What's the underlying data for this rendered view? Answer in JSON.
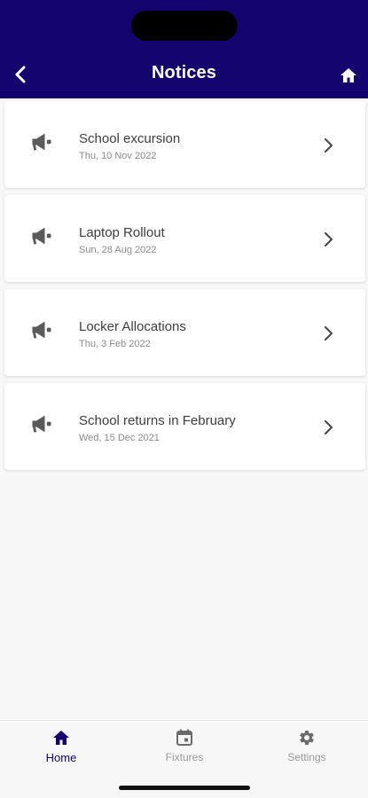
{
  "header": {
    "title": "Notices",
    "colors": {
      "background": "#13036e",
      "text": "#ffffff"
    },
    "left_icon": "chevron-left-icon",
    "right_icon": "home-icon"
  },
  "notices": [
    {
      "title": "School excursion",
      "date": "Thu, 10 Nov 2022"
    },
    {
      "title": "Laptop Rollout",
      "date": "Sun, 28 Aug 2022"
    },
    {
      "title": "Locker Allocations",
      "date": "Thu, 3 Feb 2022"
    },
    {
      "title": "School returns in February",
      "date": "Wed, 15 Dec 2021"
    }
  ],
  "notice_icon": "megaphone-icon",
  "bottom_nav": {
    "items": [
      {
        "label": "Home",
        "icon": "home-icon",
        "active": true
      },
      {
        "label": "Fixtures",
        "icon": "calendar-icon",
        "active": false
      },
      {
        "label": "Settings",
        "icon": "gear-icon",
        "active": false
      }
    ],
    "active_color": "#13036e",
    "inactive_color": "#9a9a9a"
  }
}
